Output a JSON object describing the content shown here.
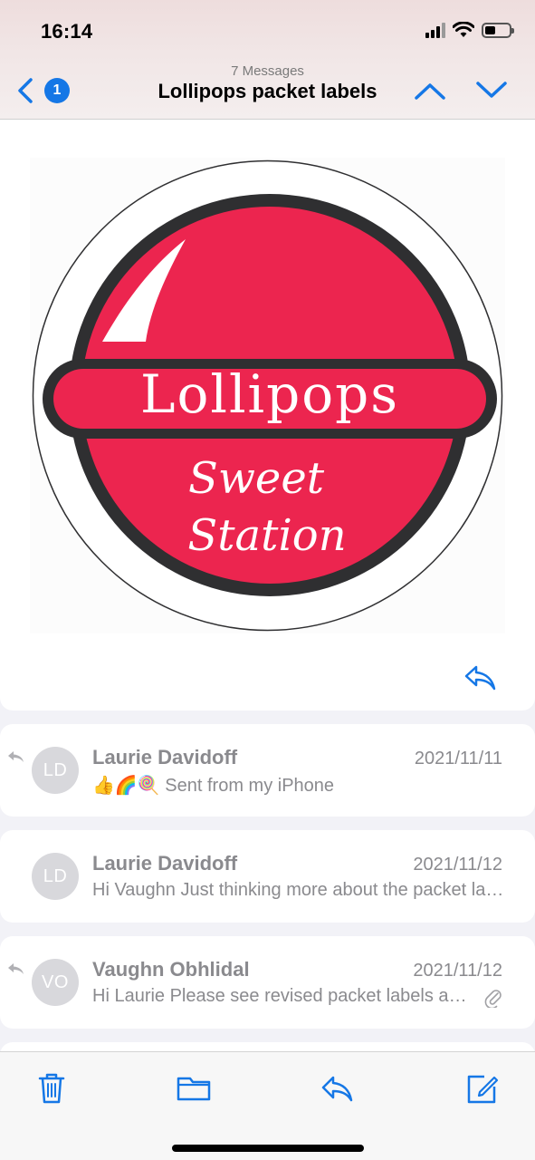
{
  "status_bar": {
    "time": "16:14"
  },
  "header": {
    "back_badge": "1",
    "message_count": "7 Messages",
    "title": "Lollipops packet labels"
  },
  "logo": {
    "line1": "Lollipops",
    "line2": "Sweet",
    "line3": "Station",
    "colors": {
      "red": "#ec254f",
      "dark": "#2f2f31",
      "white": "#ffffff"
    }
  },
  "messages": [
    {
      "initials": "LD",
      "sender": "Laurie Davidoff",
      "date": "2021/11/11",
      "emojis": "👍🌈🍭",
      "preview": "Sent from my iPhone",
      "replied": true,
      "attachment": false
    },
    {
      "initials": "LD",
      "sender": "Laurie Davidoff",
      "date": "2021/11/12",
      "preview": "Hi Vaughn Just thinking more about the packet labels",
      "replied": false,
      "attachment": false
    },
    {
      "initials": "VO",
      "sender": "Vaughn Obhlidal",
      "date": "2021/11/12",
      "preview": "Hi Laurie Please see revised packet labels attached",
      "replied": true,
      "attachment": true
    }
  ],
  "colors": {
    "accent": "#1577e6",
    "muted": "#8a8a8e"
  }
}
